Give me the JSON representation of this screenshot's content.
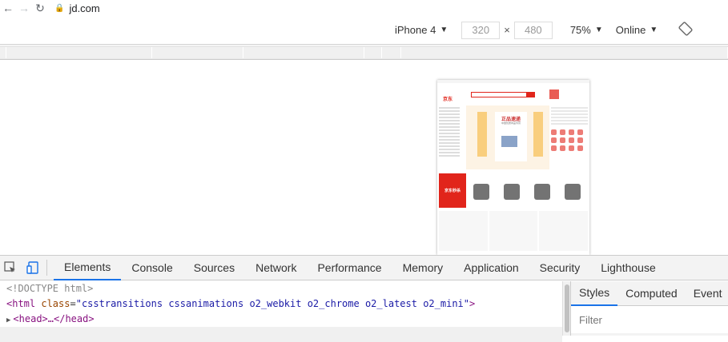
{
  "browser": {
    "url": "jd.com"
  },
  "device_toolbar": {
    "device": "iPhone 4",
    "width": "320",
    "height": "480",
    "times": "×",
    "zoom": "75%",
    "network": "Online"
  },
  "mobile_page": {
    "logo_text": "京东",
    "banner_title": "正品速递",
    "banner_subtitle": "中国优质商品专营",
    "seckill_label": "京东秒杀"
  },
  "devtools": {
    "tabs": [
      "Elements",
      "Console",
      "Sources",
      "Network",
      "Performance",
      "Memory",
      "Application",
      "Security",
      "Lighthouse"
    ],
    "active_tab": "Elements",
    "dom": {
      "doctype": "<!DOCTYPE html>",
      "html_tag_open": "<html",
      "html_attr": "class",
      "html_attr_value": "\"csstransitions cssanimations o2_webkit o2_chrome o2_latest o2_mini\"",
      "html_tag_close": ">",
      "head_line": "<head>…</head>"
    },
    "styles": {
      "tabs": [
        "Styles",
        "Computed",
        "Event"
      ],
      "filter_placeholder": "Filter"
    }
  }
}
